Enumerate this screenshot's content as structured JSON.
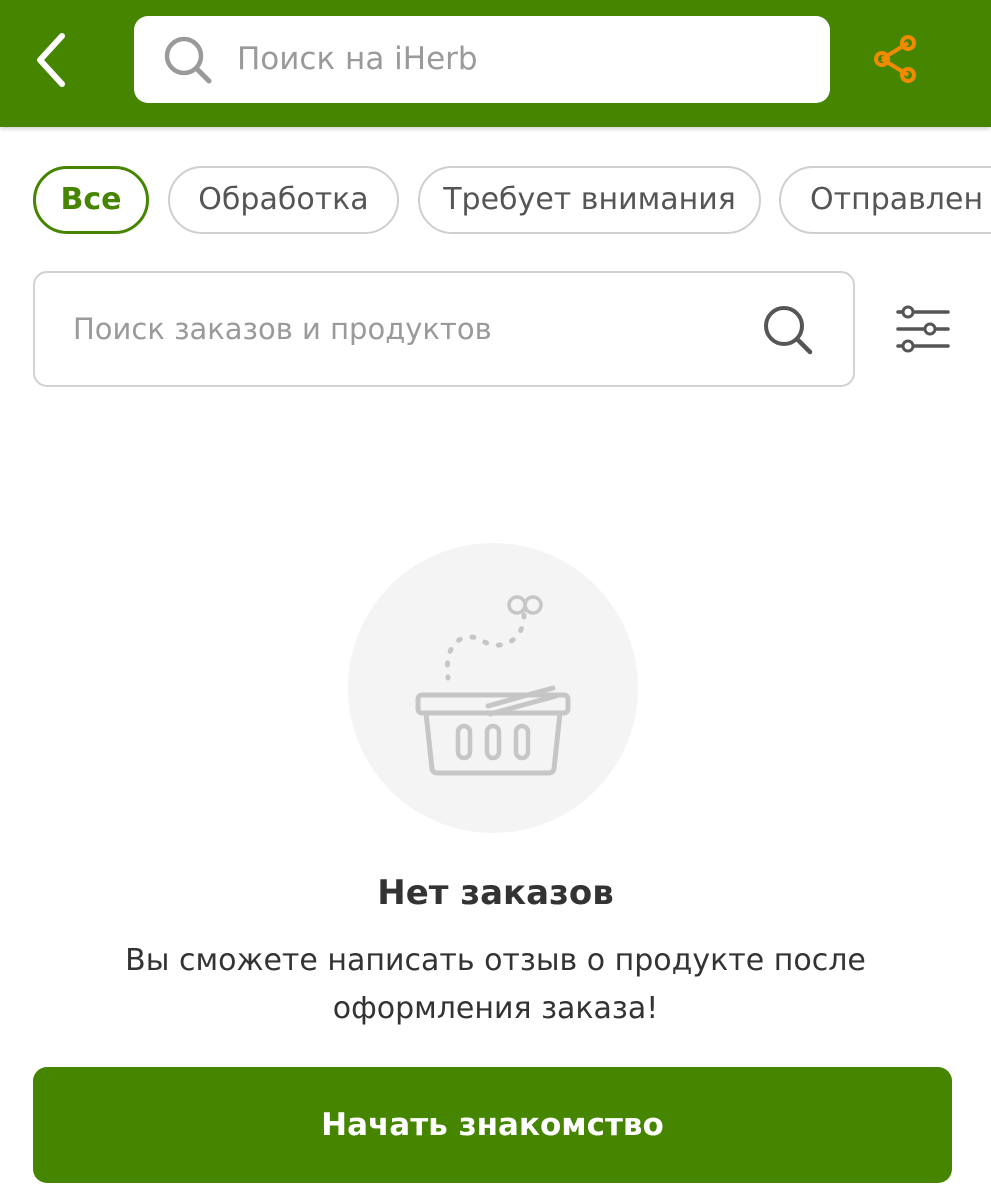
{
  "header": {
    "search_placeholder": "Поиск на iHerb",
    "brand_color": "#458500",
    "share_color": "#F08A00",
    "icons": [
      "back-arrow-icon",
      "search-icon",
      "share-icon"
    ]
  },
  "filters": {
    "chips": [
      {
        "label": "Все",
        "active": true
      },
      {
        "label": "Обработка",
        "active": false
      },
      {
        "label": "Требует внимания",
        "active": false
      },
      {
        "label": "Отправлен",
        "active": false
      }
    ]
  },
  "order_search": {
    "placeholder": "Поиск заказов и продуктов",
    "icons": [
      "search-icon",
      "filter-sliders-icon"
    ]
  },
  "empty_state": {
    "icon": "empty-basket-icon",
    "title": "Нет заказов",
    "message": "Вы сможете написать отзыв о продукте после оформления заказа!"
  },
  "cta": {
    "label": "Начать знакомство"
  }
}
